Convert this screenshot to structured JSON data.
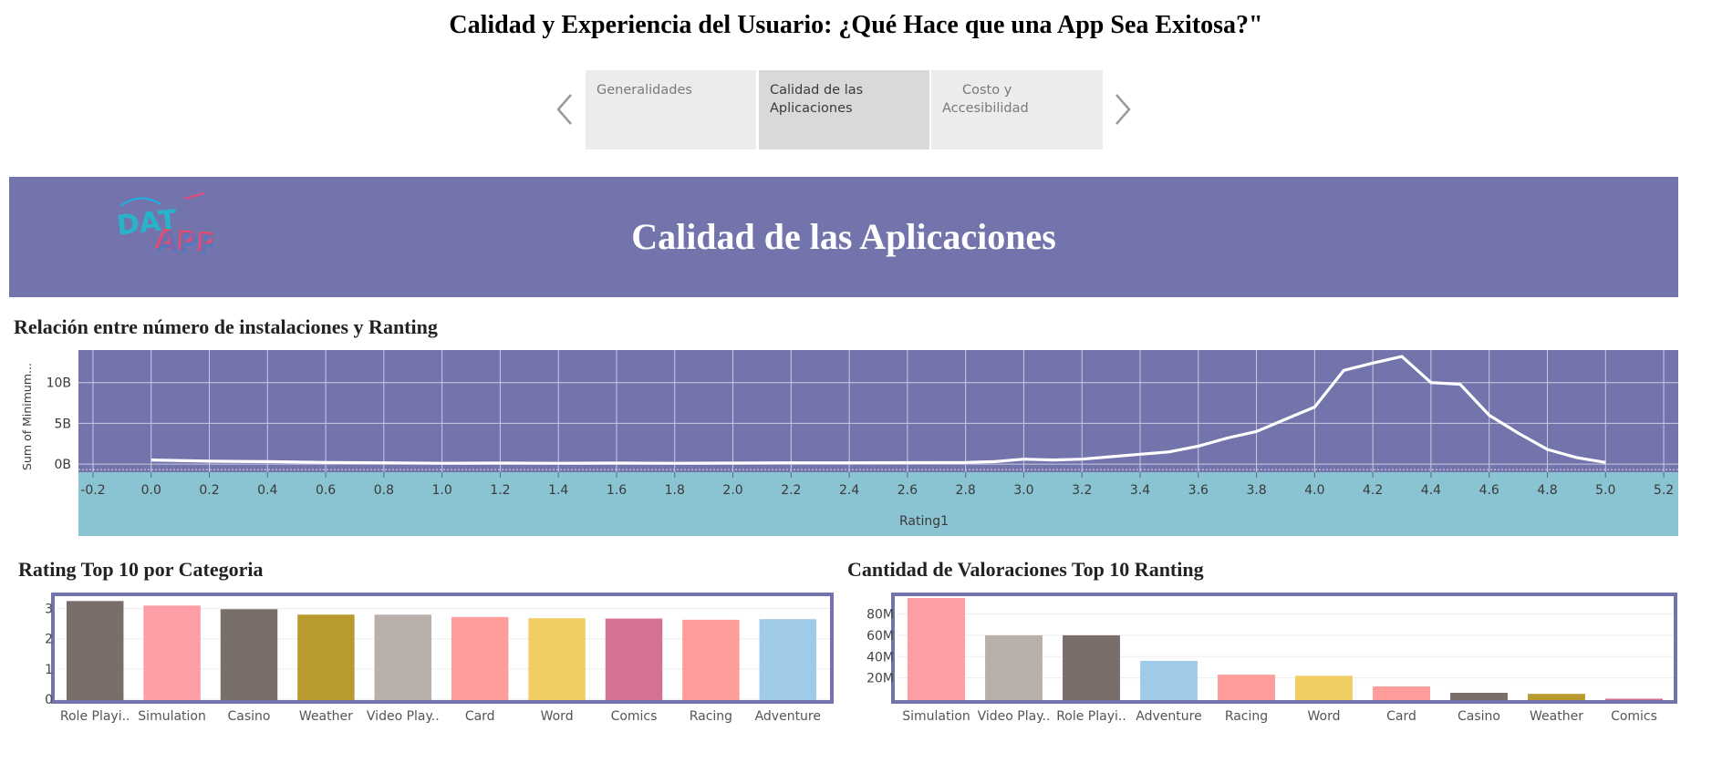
{
  "page": {
    "title": "Calidad y Experiencia del Usuario: ¿Qué Hace que una App Sea Exitosa?\""
  },
  "tabs": [
    {
      "label_lines": [
        "Generalidades"
      ],
      "active": false
    },
    {
      "label_lines": [
        "Calidad de las",
        "Aplicaciones"
      ],
      "active": true
    },
    {
      "label_lines": [
        "Costo y",
        "Accesibilidad"
      ],
      "active": false
    }
  ],
  "nav": {
    "prev_icon": "chevron-left-icon",
    "next_icon": "chevron-right-icon"
  },
  "banner": {
    "title": "Calidad de las Aplicaciones",
    "logo_text": "DATAPP",
    "color": "#7274ab"
  },
  "sections": {
    "line": {
      "title": "Relación entre número de instalaciones y Ranting"
    },
    "bar1": {
      "title": "Rating Top 10 por Categoria"
    },
    "bar2": {
      "title": "Cantidad de Valoraciones Top 10 Ranting"
    }
  },
  "chart_data": [
    {
      "type": "line",
      "xlabel": "Rating1",
      "ylabel": "Sum of Minimum...",
      "xlim": [
        -0.25,
        5.25
      ],
      "ylim": [
        -1,
        14
      ],
      "xticks": [
        "-0.2",
        "0.0",
        "0.2",
        "0.4",
        "0.6",
        "0.8",
        "1.0",
        "1.2",
        "1.4",
        "1.6",
        "1.8",
        "2.0",
        "2.2",
        "2.4",
        "2.6",
        "2.8",
        "3.0",
        "3.2",
        "3.4",
        "3.6",
        "3.8",
        "4.0",
        "4.2",
        "4.4",
        "4.6",
        "4.8",
        "5.0",
        "5.2"
      ],
      "yticks": [
        {
          "v": 0,
          "label": "0B"
        },
        {
          "v": 5,
          "label": "5B"
        },
        {
          "v": 10,
          "label": "10B"
        }
      ],
      "grid": true,
      "colors": {
        "plot_bg": "#7274ab",
        "axis_bg": "#8ac3d1",
        "line": "#ffffff"
      },
      "series": [
        {
          "x": [
            0.0,
            0.2,
            0.4,
            0.6,
            0.8,
            1.0,
            1.2,
            1.4,
            1.6,
            1.8,
            2.0,
            2.2,
            2.4,
            2.6,
            2.8,
            2.9,
            3.0,
            3.1,
            3.2,
            3.3,
            3.4,
            3.5,
            3.6,
            3.7,
            3.8,
            3.9,
            4.0,
            4.1,
            4.2,
            4.3,
            4.4,
            4.5,
            4.6,
            4.7,
            4.8,
            4.9,
            5.0
          ],
          "y": [
            0.5,
            0.35,
            0.3,
            0.2,
            0.15,
            0.1,
            0.12,
            0.1,
            0.12,
            0.1,
            0.12,
            0.15,
            0.15,
            0.18,
            0.2,
            0.3,
            0.6,
            0.5,
            0.6,
            0.9,
            1.2,
            1.5,
            2.2,
            3.2,
            4.0,
            5.5,
            7.0,
            11.5,
            12.4,
            13.2,
            10.0,
            9.8,
            6.0,
            3.8,
            1.8,
            0.8,
            0.2
          ]
        }
      ]
    },
    {
      "type": "bar",
      "categories": [
        "Role Playi..",
        "Simulation",
        "Casino",
        "Weather",
        "Video Play..",
        "Card",
        "Word",
        "Comics",
        "Racing",
        "Adventure"
      ],
      "values": [
        3.25,
        3.1,
        2.98,
        2.8,
        2.8,
        2.72,
        2.68,
        2.67,
        2.63,
        2.65
      ],
      "ylim": [
        0,
        3.35
      ],
      "yticks": [
        {
          "v": 0,
          "label": "0"
        },
        {
          "v": 1,
          "label": "1"
        },
        {
          "v": 2,
          "label": "2"
        },
        {
          "v": 3,
          "label": "3"
        }
      ],
      "colors": [
        "#7a6e6b",
        "#fd9ea7",
        "#7a6e6b",
        "#b89a2e",
        "#bab0ab",
        "#ff9d9a",
        "#f1ce63",
        "#d37295",
        "#ff9d9a",
        "#a0cbe8"
      ],
      "frame_color": "#7274ab"
    },
    {
      "type": "bar",
      "categories": [
        "Simulation",
        "Video Play..",
        "Role Playi..",
        "Adventure",
        "Racing",
        "Word",
        "Card",
        "Casino",
        "Weather",
        "Comics"
      ],
      "values": [
        95,
        60,
        60,
        36,
        23,
        22,
        12,
        6,
        5,
        0.5
      ],
      "ylim": [
        0,
        95
      ],
      "yticks": [
        {
          "v": 20,
          "label": "20M"
        },
        {
          "v": 40,
          "label": "40M"
        },
        {
          "v": 60,
          "label": "60M"
        },
        {
          "v": 80,
          "label": "80M"
        }
      ],
      "colors": [
        "#fd9ea7",
        "#bab0ab",
        "#7a6e6b",
        "#a0cbe8",
        "#ff9d9a",
        "#f1ce63",
        "#ff9d9a",
        "#7a6e6b",
        "#b89a2e",
        "#d37295"
      ],
      "frame_color": "#7274ab"
    }
  ]
}
